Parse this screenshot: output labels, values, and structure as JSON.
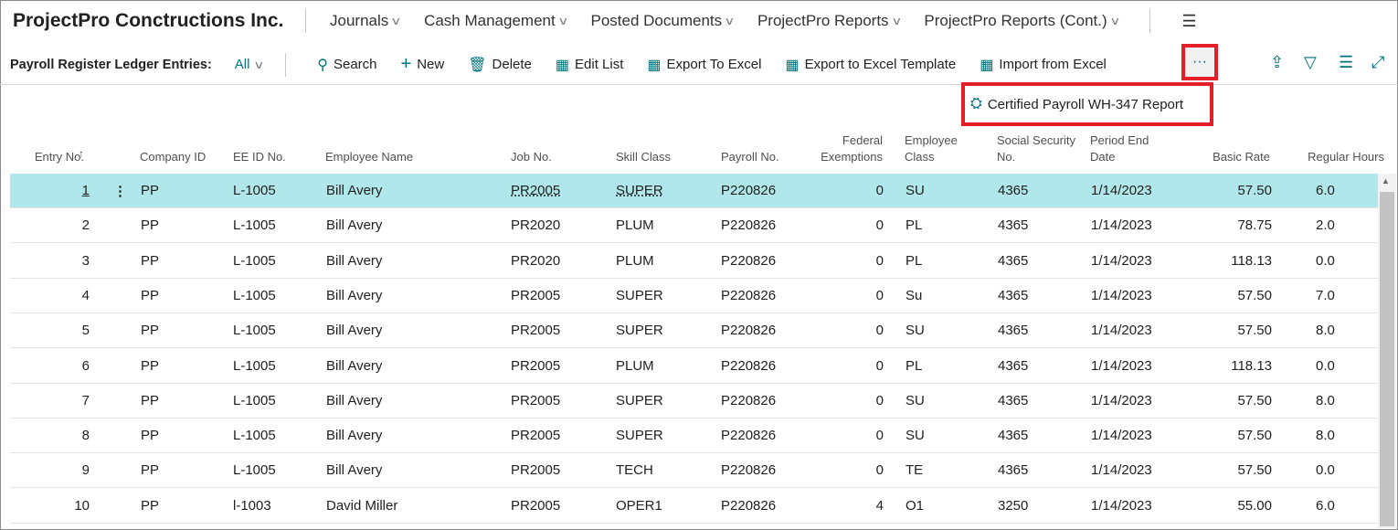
{
  "app": {
    "company": "ProjectPro Conctructions Inc.",
    "nav": [
      "Journals",
      "Cash Management",
      "Posted Documents",
      "ProjectPro Reports",
      "ProjectPro Reports (Cont.)"
    ]
  },
  "page": {
    "title": "Payroll Register Ledger Entries:",
    "view": "All"
  },
  "actions": {
    "search": "Search",
    "new": "New",
    "delete": "Delete",
    "edit_list": "Edit List",
    "export_excel": "Export To Excel",
    "export_template": "Export to Excel Template",
    "import_excel": "Import from Excel",
    "more": "···"
  },
  "dropdown": {
    "item": "Certified Payroll WH-347 Report"
  },
  "columns": [
    "Entry No.",
    "Company ID",
    "EE ID No.",
    "Employee Name",
    "Job No.",
    "Skill Class",
    "Payroll No.",
    "Federal Exemptions",
    "Employee Class",
    "Social Security No.",
    "Period End Date",
    "Basic Rate",
    "Regular Hours"
  ],
  "rows": [
    [
      "1",
      "PP",
      "L-1005",
      "Bill Avery",
      "PR2005",
      "SUPER",
      "P220826",
      "0",
      "SU",
      "4365",
      "1/14/2023",
      "57.50",
      "6.0"
    ],
    [
      "2",
      "PP",
      "L-1005",
      "Bill Avery",
      "PR2020",
      "PLUM",
      "P220826",
      "0",
      "PL",
      "4365",
      "1/14/2023",
      "78.75",
      "2.0"
    ],
    [
      "3",
      "PP",
      "L-1005",
      "Bill Avery",
      "PR2020",
      "PLUM",
      "P220826",
      "0",
      "PL",
      "4365",
      "1/14/2023",
      "118.13",
      "0.0"
    ],
    [
      "4",
      "PP",
      "L-1005",
      "Bill Avery",
      "PR2005",
      "SUPER",
      "P220826",
      "0",
      "Su",
      "4365",
      "1/14/2023",
      "57.50",
      "7.0"
    ],
    [
      "5",
      "PP",
      "L-1005",
      "Bill Avery",
      "PR2005",
      "SUPER",
      "P220826",
      "0",
      "SU",
      "4365",
      "1/14/2023",
      "57.50",
      "8.0"
    ],
    [
      "6",
      "PP",
      "L-1005",
      "Bill Avery",
      "PR2005",
      "PLUM",
      "P220826",
      "0",
      "PL",
      "4365",
      "1/14/2023",
      "118.13",
      "0.0"
    ],
    [
      "7",
      "PP",
      "L-1005",
      "Bill Avery",
      "PR2005",
      "SUPER",
      "P220826",
      "0",
      "SU",
      "4365",
      "1/14/2023",
      "57.50",
      "8.0"
    ],
    [
      "8",
      "PP",
      "L-1005",
      "Bill Avery",
      "PR2005",
      "SUPER",
      "P220826",
      "0",
      "SU",
      "4365",
      "1/14/2023",
      "57.50",
      "8.0"
    ],
    [
      "9",
      "PP",
      "L-1005",
      "Bill Avery",
      "PR2005",
      "TECH",
      "P220826",
      "0",
      "TE",
      "4365",
      "1/14/2023",
      "57.50",
      "0.0"
    ],
    [
      "10",
      "PP",
      "l-1003",
      "David Miller",
      "PR2005",
      "OPER1",
      "P220826",
      "4",
      "O1",
      "3250",
      "1/14/2023",
      "55.00",
      "6.0"
    ]
  ],
  "colors": {
    "accent": "#00737a",
    "selected_row": "#b0e7ea",
    "highlight": "#e21f26"
  }
}
